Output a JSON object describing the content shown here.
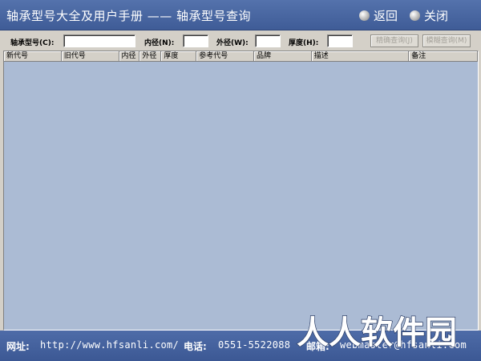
{
  "window": {
    "title": "轴承型号大全及用户手册 —— 轴承型号查询",
    "buttons": {
      "back": "返回",
      "close": "关闭"
    }
  },
  "search": {
    "model_label": "轴承型号(C):",
    "inner_label": "内径(N):",
    "outer_label": "外径(W):",
    "thickness_label": "厚度(H):",
    "model_value": "",
    "inner_value": "",
    "outer_value": "",
    "thickness_value": "",
    "exact_button": "精确查询(J)",
    "fuzzy_button": "模糊查询(M)"
  },
  "table": {
    "columns": [
      "新代号",
      "旧代号",
      "内径",
      "外径",
      "厚度",
      "参考代号",
      "品牌",
      "描述",
      "备注"
    ],
    "rows": []
  },
  "status": {
    "website_label": "网址:",
    "website": "http://www.hfsanli.com/",
    "phone_label": "电话:",
    "phone": "0551-5522088",
    "email_label": "邮箱:",
    "email": "webmaster@hfsanli.com"
  },
  "watermark": {
    "text": "人人软件园"
  },
  "colors": {
    "titlebar": "#4a68a3",
    "grid_background": "#abbbd4",
    "chrome": "#d4d0c8",
    "text_light": "#ffffff"
  }
}
